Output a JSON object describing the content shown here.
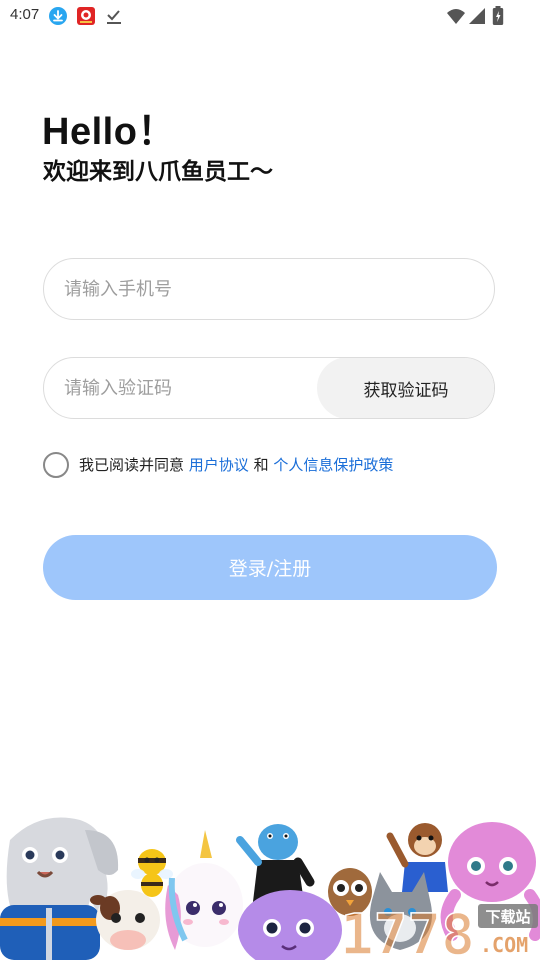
{
  "status_bar": {
    "time": "4:07",
    "icons": [
      "download-icon",
      "app-notification-icon",
      "check-download-icon",
      "wifi-icon",
      "signal-icon",
      "battery-icon"
    ]
  },
  "greeting": {
    "hello": "Hello！",
    "welcome": "欢迎来到八爪鱼员工～"
  },
  "form": {
    "phone_placeholder": "请输入手机号",
    "code_placeholder": "请输入验证码",
    "get_code_label": "获取验证码"
  },
  "agreement": {
    "checked": false,
    "prefix": "我已阅读并同意 ",
    "user_agreement": "用户协议",
    "and": " 和 ",
    "privacy_policy": "个人信息保护政策"
  },
  "login": {
    "label": "登录/注册"
  },
  "watermark": {
    "brand": "1778",
    "site": "下载站",
    "domain": ".COM"
  },
  "colors": {
    "accent": "#9ec6fb",
    "link": "#1a6ed8"
  }
}
